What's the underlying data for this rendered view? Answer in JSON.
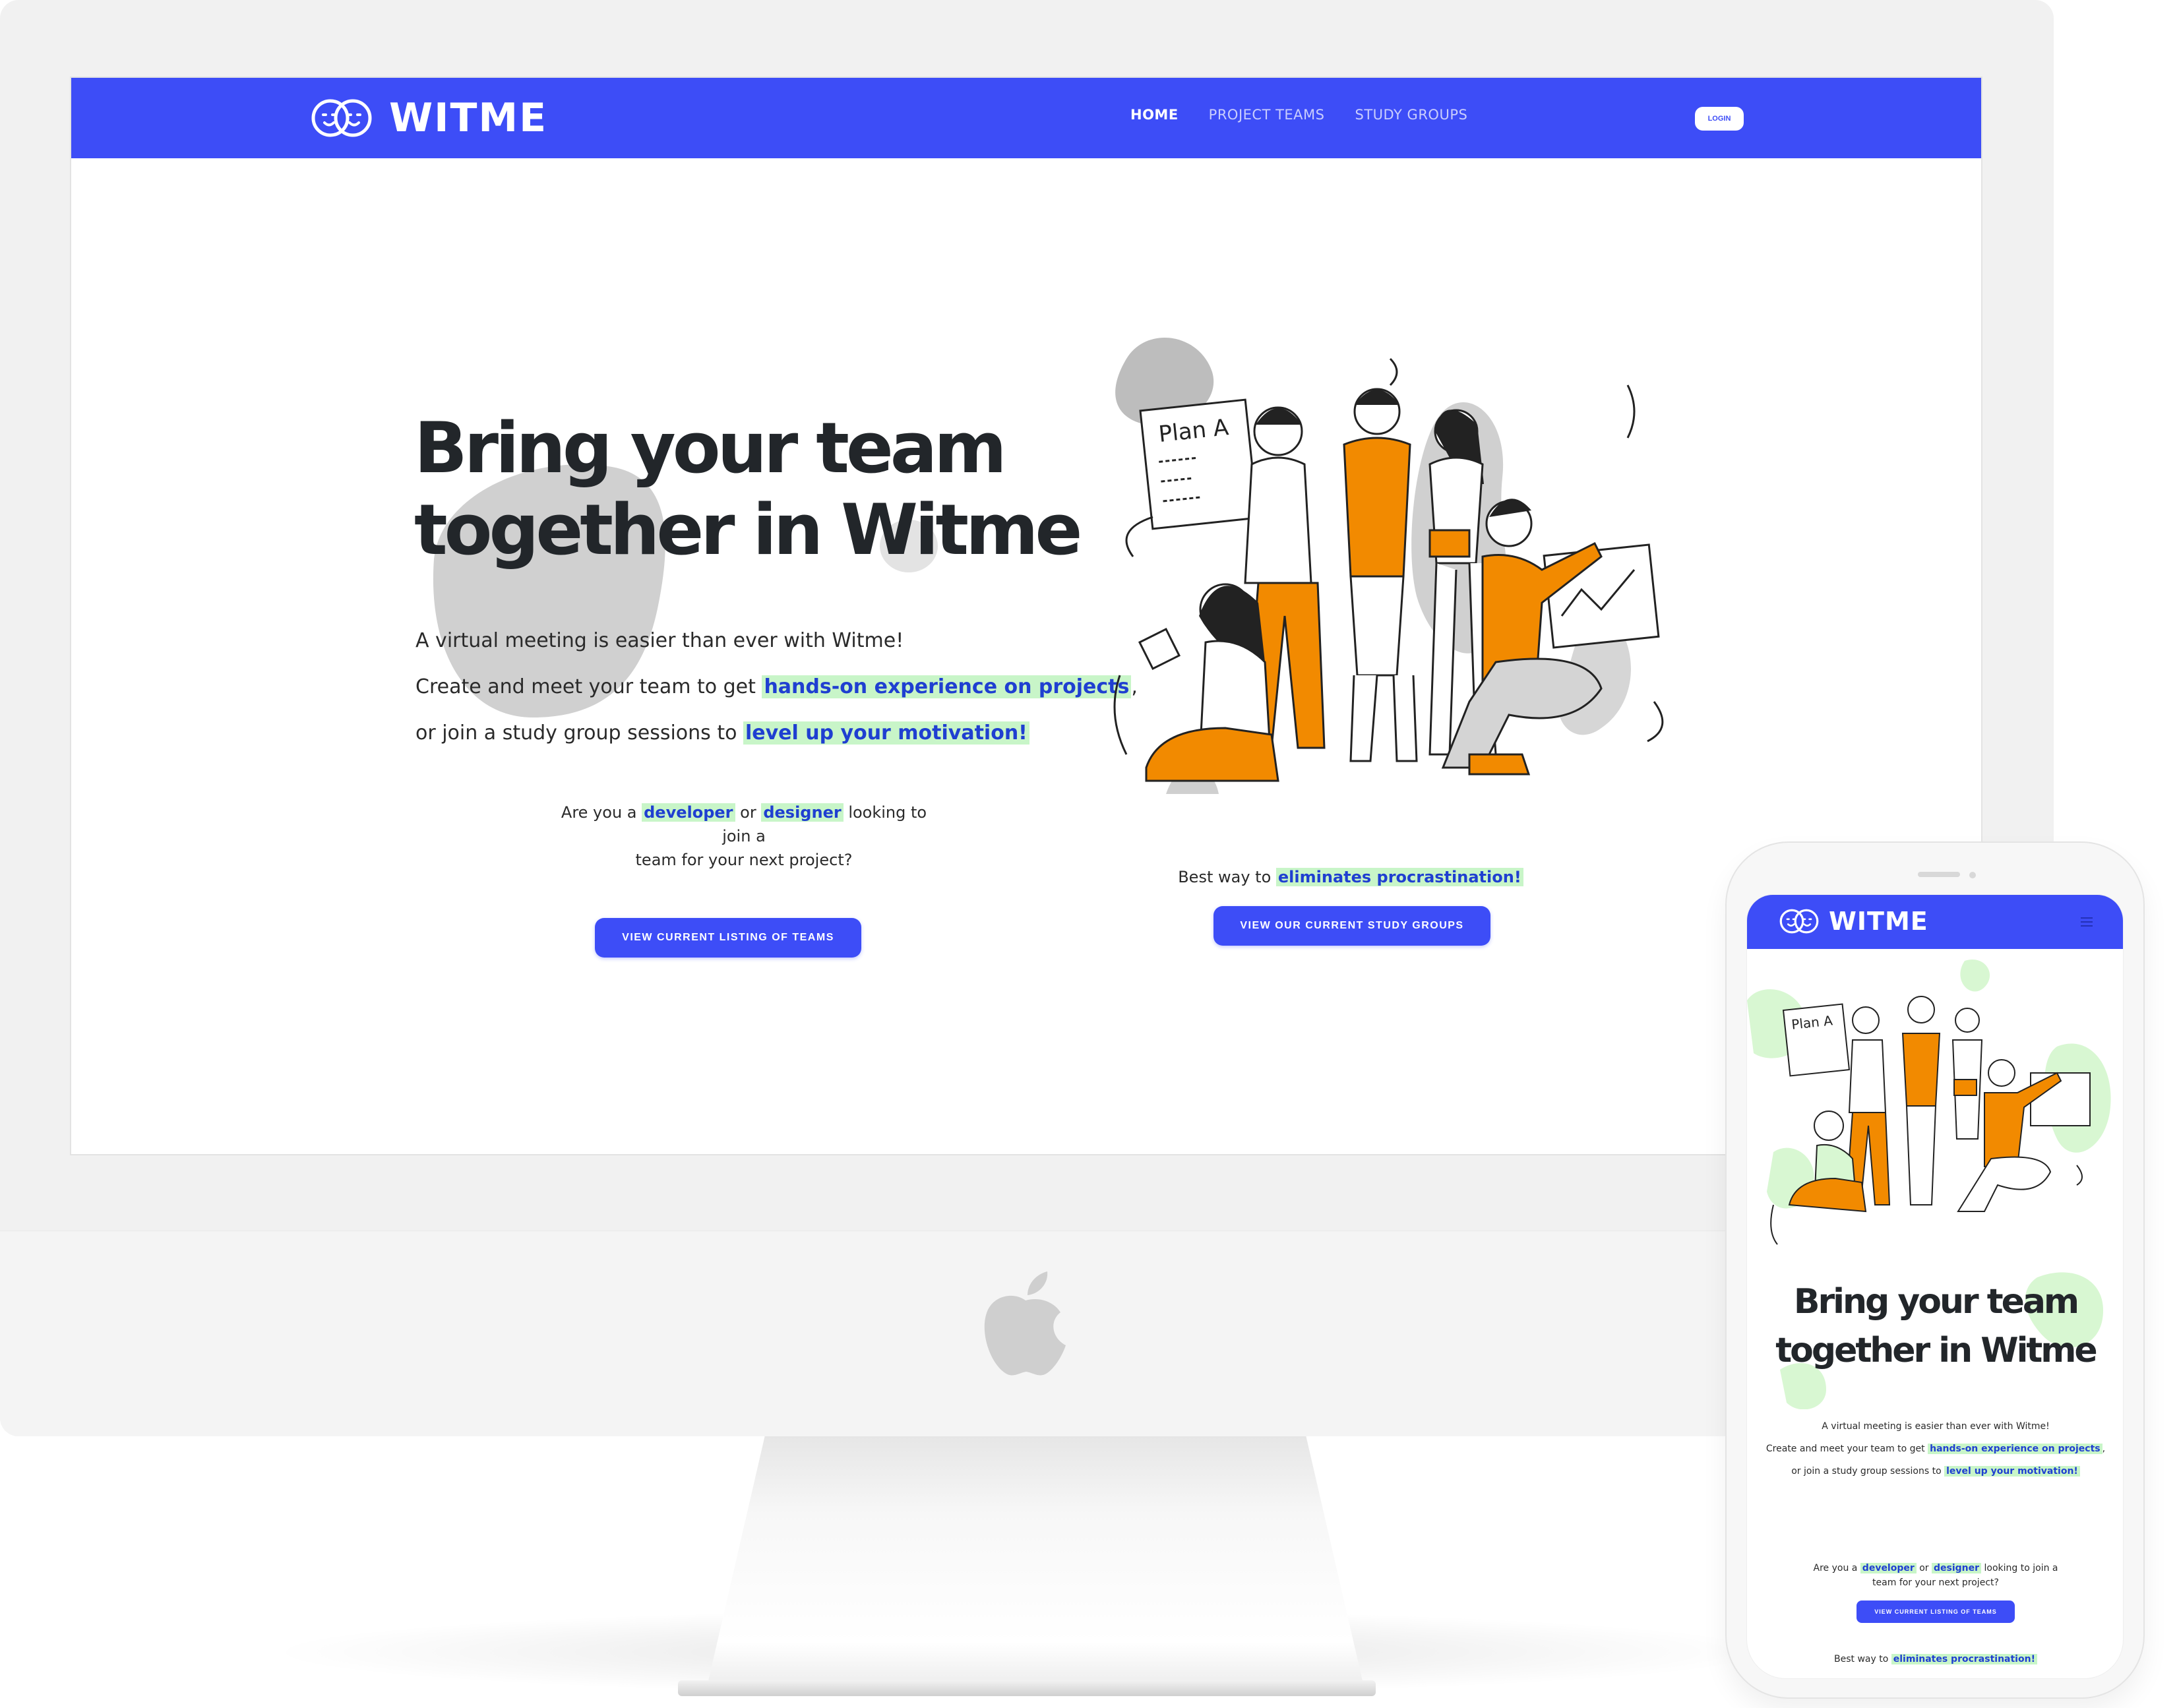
{
  "site": {
    "brand": "WITME",
    "nav": [
      {
        "label": "HOME",
        "active": true
      },
      {
        "label": "PROJECT TEAMS",
        "active": false
      },
      {
        "label": "STUDY GROUPS",
        "active": false
      }
    ],
    "login_label": "LOGIN",
    "hero": {
      "title_line1": "Bring your team",
      "title_line2": "together in Witme",
      "line1": "A virtual meeting is easier than ever with Witme!",
      "line2_pre": "Create and meet your team to get ",
      "line2_highlight": "hands-on experience on projects",
      "line2_post": ",",
      "line3_pre": "or join a study group sessions to ",
      "line3_highlight": "level up your motivation!",
      "illustration_sign": "Plan A"
    },
    "teams_cta": {
      "text_pre": "Are you a ",
      "highlight1": "developer",
      "text_mid": " or ",
      "highlight2": "designer",
      "text_post1": " looking to join a",
      "text_post2": "team for your next project?",
      "button_label": "VIEW CURRENT LISTING OF TEAMS"
    },
    "study_cta": {
      "text_pre": "Best way to ",
      "highlight": "eliminates procrastination!",
      "button_label": "VIEW OUR CURRENT STUDY GROUPS"
    }
  },
  "colors": {
    "brand_blue": "#3d4df7",
    "highlight_bg": "#c8f5c8",
    "highlight_text": "#1f3fd1",
    "illustration_orange": "#f28a00",
    "desktop_blob": "#cfcfcf",
    "mobile_blob": "#d8f7d2"
  },
  "icons": {
    "brand_logo": "two-faces-logo-icon",
    "apple": "apple-logo-icon",
    "mobile_menu": "hamburger-menu-icon"
  }
}
